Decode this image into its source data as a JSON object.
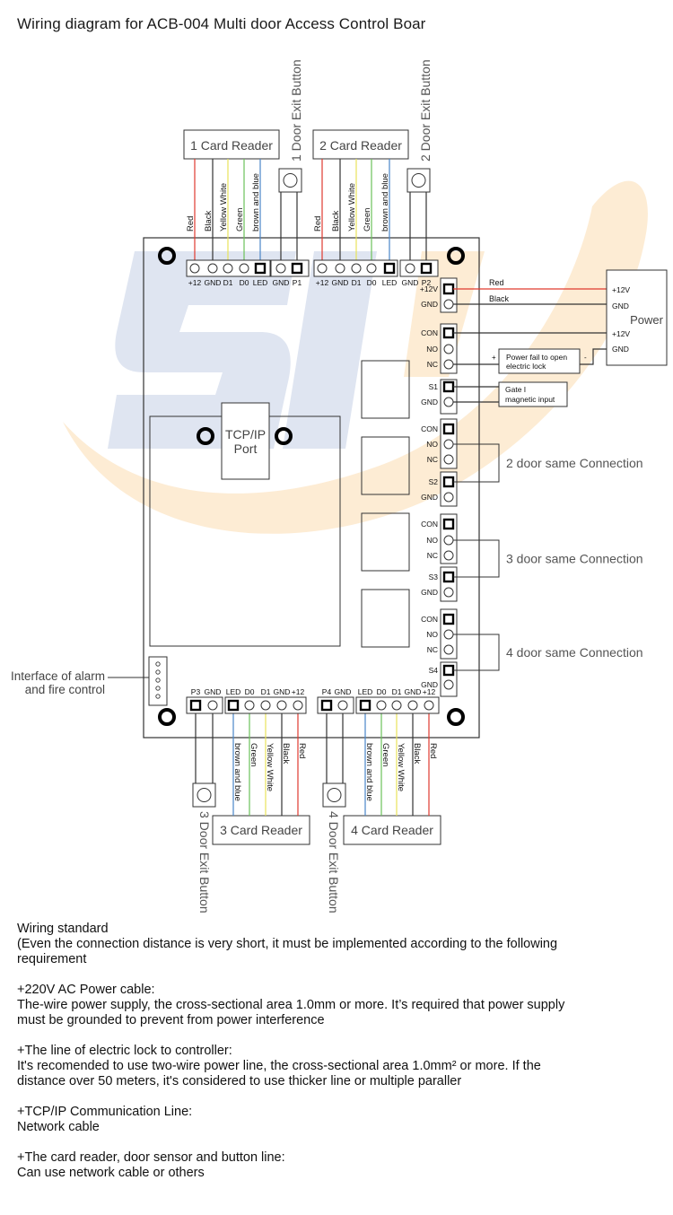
{
  "title": "Wiring diagram for ACB-004 Multi door Access Control Boar",
  "watermark": {
    "text": "SLI",
    "blue": "#dfe5f1",
    "orange": "#fde9cc"
  },
  "colors": {
    "red": "#e03a2e",
    "black": "#333333",
    "yellow": "#e8e35a",
    "green": "#6cc15a",
    "blue": "#4a86c8",
    "outline": "#333333"
  },
  "readers": [
    {
      "label": "1 Card Reader",
      "pins": [
        "+12",
        "GND",
        "D1",
        "D0",
        "LED"
      ],
      "wires": [
        "Red",
        "Black",
        "Yellow White",
        "Green",
        "brown and blue"
      ]
    },
    {
      "label": "2 Card Reader",
      "pins": [
        "+12",
        "GND",
        "D1",
        "D0",
        "LED"
      ],
      "wires": [
        "Red",
        "Black",
        "Yellow White",
        "Green",
        "brown and blue"
      ]
    },
    {
      "label": "3 Card Reader",
      "pins": [
        "LED",
        "D0",
        "D1",
        "GND",
        "+12"
      ],
      "wires": [
        "brown and blue",
        "Green",
        "Yellow White",
        "Black",
        "Red"
      ]
    },
    {
      "label": "4 Card Reader",
      "pins": [
        "LED",
        "D0",
        "D1",
        "GND",
        "+12"
      ],
      "wires": [
        "brown and blue",
        "Green",
        "Yellow White",
        "Black",
        "Red"
      ]
    }
  ],
  "exit_buttons": [
    {
      "label": "1 Door Exit Button",
      "pins": [
        "GND",
        "P1"
      ]
    },
    {
      "label": "2 Door Exit Button",
      "pins": [
        "GND",
        "P2"
      ]
    },
    {
      "label": "3 Door Exit Button",
      "pins": [
        "P3",
        "GND"
      ]
    },
    {
      "label": "4 Door Exit Button",
      "pins": [
        "P4",
        "GND"
      ]
    }
  ],
  "power_terminal": {
    "pins": [
      "+12V",
      "GND"
    ],
    "wires": [
      "Red",
      "Black"
    ]
  },
  "power_box": {
    "label": "Power",
    "pins": [
      "+12V",
      "GND",
      "+12V",
      "GND"
    ]
  },
  "relay_blocks": [
    {
      "pins": [
        "CON",
        "NO",
        "NC"
      ],
      "sensor": [
        "S1",
        "GND"
      ]
    },
    {
      "pins": [
        "CON",
        "NO",
        "NC"
      ],
      "sensor": [
        "S2",
        "GND"
      ],
      "note": "2 door same Connection"
    },
    {
      "pins": [
        "CON",
        "NO",
        "NC"
      ],
      "sensor": [
        "S3",
        "GND"
      ],
      "note": "3 door same Connection"
    },
    {
      "pins": [
        "CON",
        "NO",
        "NC"
      ],
      "sensor": [
        "S4",
        "GND"
      ],
      "note": "4 door same Connection"
    }
  ],
  "lock_box": {
    "line1": "Power fail to open",
    "line2": "electric lock",
    "plus": "+",
    "minus": "-"
  },
  "gate_box": {
    "line1": "Gate I",
    "line2": "magnetic input"
  },
  "tcpip": {
    "line1": "TCP/IP",
    "line2": "Port"
  },
  "alarm_interface": {
    "line1": "Interface of alarm",
    "line2": "and fire control"
  },
  "notes": [
    {
      "lines": [
        "Wiring standard",
        "(Even the connection distance is very short, it must be implemented according to the following",
        "requirement"
      ]
    },
    {
      "lines": [
        "+220V AC Power cable:",
        "The-wire power supply, the cross-sectional area 1.0mm or more. It’s required that power supply",
        "must be grounded to prevent from power interference"
      ]
    },
    {
      "lines": [
        "+The line of electric lock to controller:",
        "It's recomended to use two-wire power line, the cross-sectional area 1.0mm² or more. If the",
        "distance over 50 meters, it's considered to use thicker line or multiple paraller"
      ]
    },
    {
      "lines": [
        "+TCP/IP Communication Line:",
        "Network cable"
      ]
    },
    {
      "lines": [
        "+The card reader, door sensor and button line:",
        "Can use network cable or others"
      ]
    }
  ]
}
